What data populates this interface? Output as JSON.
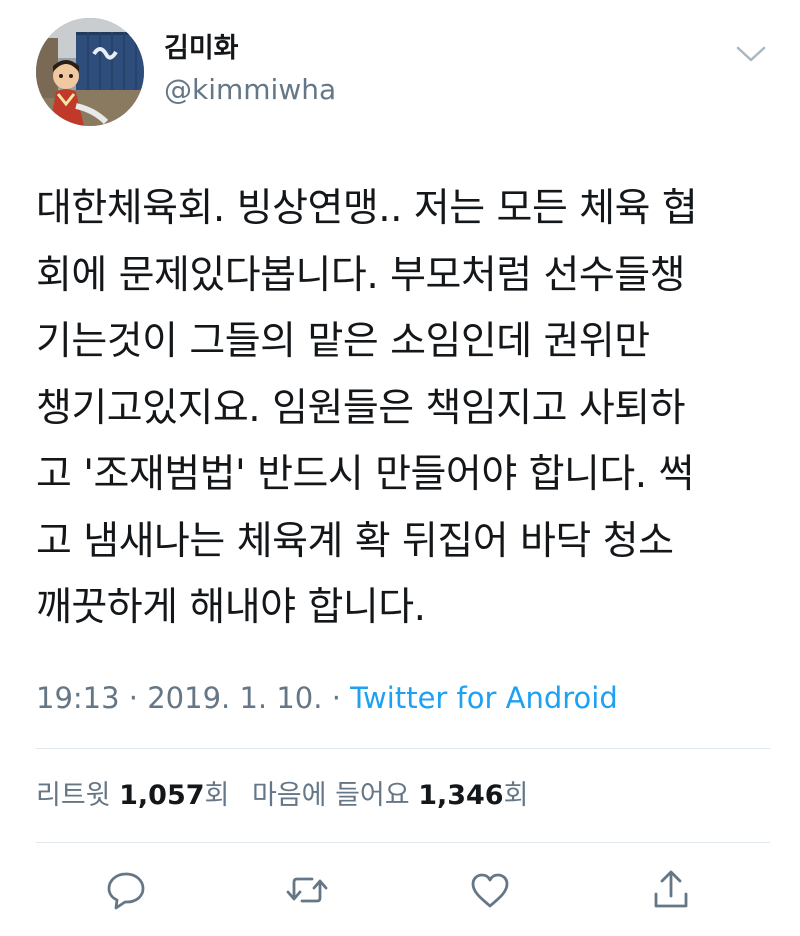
{
  "tweet": {
    "display_name": "김미화",
    "handle": "@kimmiwha",
    "text": "대한체육회. 빙상연맹.. 저는 모든 체육 협\n회에 문제있다봅니다. 부모처럼 선수들챙\n기는것이 그들의 맡은 소임인데 권위만\n챙기고있지요. 임원들은 책임지고 사퇴하\n고 '조재범법' 반드시 만들어야 합니다. 썩\n고 냄새나는 체육계 확 뒤집어  바닥 청소\n깨끗하게 해내야 합니다.",
    "time": "19:13",
    "date": "2019. 1. 10.",
    "separator": "·",
    "source": "Twitter for Android"
  },
  "stats": {
    "retweets_label": "리트윗",
    "retweets_count": "1,057",
    "retweets_suffix": "회",
    "likes_label": "마음에 들어요",
    "likes_count": "1,346",
    "likes_suffix": "회"
  },
  "icons": {
    "more": "chevron-down-icon",
    "reply": "reply-icon",
    "retweet": "retweet-icon",
    "like": "heart-icon",
    "share": "share-icon"
  },
  "colors": {
    "text": "#14171a",
    "secondary": "#657786",
    "link": "#1da1f2",
    "divider": "#e1e8ed"
  }
}
